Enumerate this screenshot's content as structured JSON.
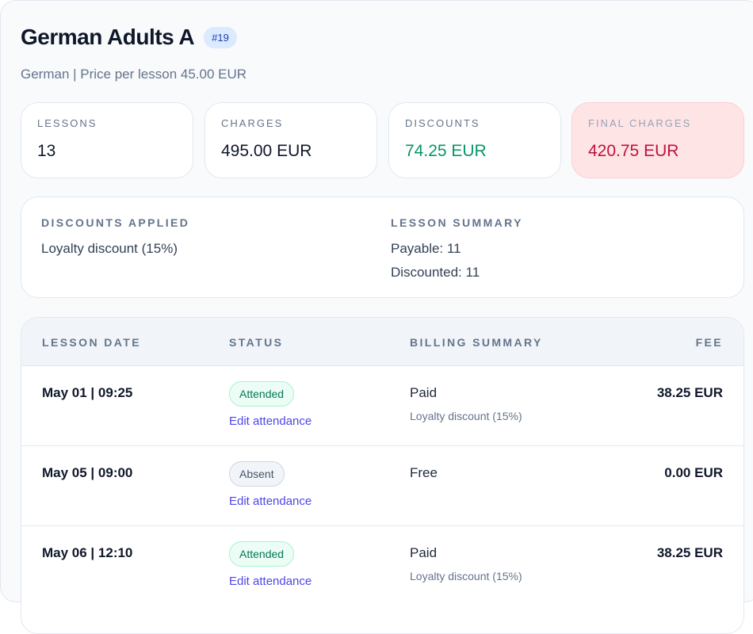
{
  "header": {
    "title": "German Adults A",
    "id_badge": "#19",
    "subtitle": "German | Price per lesson 45.00 EUR"
  },
  "stats": {
    "lessons": {
      "label": "LESSONS",
      "value": "13"
    },
    "charges": {
      "label": "CHARGES",
      "value": "495.00 EUR"
    },
    "discounts": {
      "label": "DISCOUNTS",
      "value": "74.25 EUR"
    },
    "final_charges": {
      "label": "FINAL CHARGES",
      "value": "420.75 EUR"
    }
  },
  "summary": {
    "discounts_applied_label": "DISCOUNTS APPLIED",
    "discounts_applied_text": "Loyalty discount (15%)",
    "lesson_summary_label": "LESSON SUMMARY",
    "payable": "Payable: 11",
    "discounted": "Discounted: 11"
  },
  "table": {
    "headers": [
      "LESSON DATE",
      "STATUS",
      "BILLING SUMMARY",
      "FEE"
    ],
    "rows": [
      {
        "date": "May 01 | 09:25",
        "status": "Attended",
        "edit": "Edit attendance",
        "billing": "Paid",
        "billing_note": "Loyalty discount (15%)",
        "fee": "38.25 EUR"
      },
      {
        "date": "May 05 | 09:00",
        "status": "Absent",
        "edit": "Edit attendance",
        "billing": "Free",
        "billing_note": "",
        "fee": "0.00 EUR"
      },
      {
        "date": "May 06 | 12:10",
        "status": "Attended",
        "edit": "Edit attendance",
        "billing": "Paid",
        "billing_note": "Loyalty discount (15%)",
        "fee": "38.25 EUR"
      }
    ]
  },
  "colors": {
    "discount_green": "#059669",
    "final_red": "#be123c",
    "link_indigo": "#4f46e5",
    "badge_blue": "#dbeafe"
  }
}
